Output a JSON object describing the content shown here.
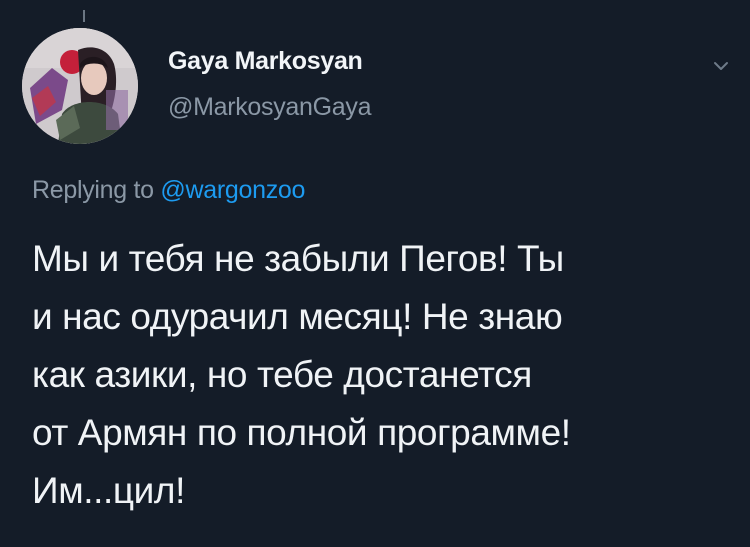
{
  "author": {
    "display_name": "Gaya Markosyan",
    "handle": "@MarkosyanGaya"
  },
  "icons": {
    "menu": "chevron-down-icon",
    "avatar": "profile-photo"
  },
  "reply": {
    "prefix": "Replying to ",
    "mention": "@wargonzoo"
  },
  "tweet": {
    "text": "Мы и тебя не забыли Пегов! Ты\nи нас одурачил месяц! Не знаю\nкак азики, но тебе достанется\nот Армян по полной программе!\nИм...цил!"
  },
  "colors": {
    "background": "#141c28",
    "primary_text": "#f0f3f6",
    "secondary_text": "#8b98a6",
    "link": "#1d9bf0"
  }
}
